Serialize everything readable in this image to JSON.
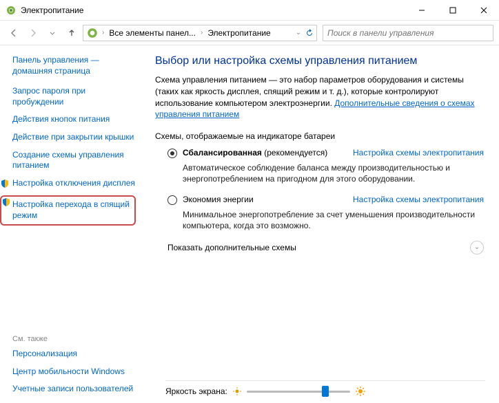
{
  "window": {
    "title": "Электропитание"
  },
  "nav": {
    "crumb1": "Все элементы панел...",
    "crumb2": "Электропитание",
    "search_placeholder": "Поиск в панели управления"
  },
  "sidebar": {
    "home1": "Панель управления —",
    "home2": "домашняя страница",
    "links": [
      "Запрос пароля при пробуждении",
      "Действия кнопок питания",
      "Действие при закрытии крышки",
      "Создание схемы управления питанием",
      "Настройка отключения дисплея",
      "Настройка перехода в спящий режим"
    ],
    "see_also_label": "См. также",
    "see_also": [
      "Персонализация",
      "Центр мобильности Windows",
      "Учетные записи пользователей"
    ]
  },
  "main": {
    "heading": "Выбор или настройка схемы управления питанием",
    "intro_text": "Схема управления питанием — это набор параметров оборудования и системы (таких как яркость дисплея, спящий режим и т. д.), которые контролируют использование компьютером электроэнергии. ",
    "intro_link": "Дополнительные сведения о схемах управления питанием",
    "section_title": "Схемы, отображаемые на индикаторе батареи",
    "plans": [
      {
        "name": "Сбалансированная",
        "suffix": " (рекомендуется)",
        "link": "Настройка схемы электропитания",
        "desc": "Автоматическое соблюдение баланса между производительностью и энергопотреблением на пригодном для этого оборудовании.",
        "checked": true
      },
      {
        "name": "Экономия энергии",
        "suffix": "",
        "link": "Настройка схемы электропитания",
        "desc": "Минимальное энергопотребление за счет уменьшения производительности компьютера, когда это возможно.",
        "checked": false
      }
    ],
    "expand_label": "Показать дополнительные схемы",
    "brightness_label": "Яркость экрана:",
    "brightness_value": 78
  }
}
